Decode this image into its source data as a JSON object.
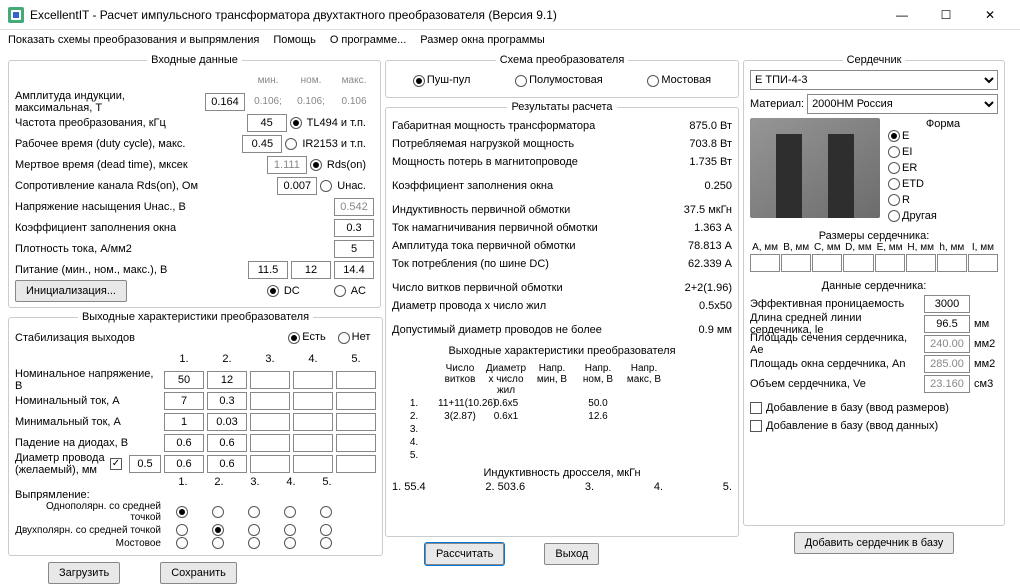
{
  "title": "ExcellentIT - Расчет импульсного трансформатора двухтактного преобразователя (Версия 9.1)",
  "menu": [
    "Показать схемы преобразования и выпрямления",
    "Помощь",
    "О программе...",
    "Размер окна программы"
  ],
  "input": {
    "legend": "Входные данные",
    "minmax": {
      "min": "мин.",
      "nom": "ном.",
      "max": "макс."
    },
    "rows": [
      {
        "label": "Амплитуда индукции, максимальная, Т",
        "val": "0.164",
        "min": "0.106;",
        "nom": "0.106;",
        "max": "0.106"
      },
      {
        "label": "Частота преобразования, кГц",
        "val": "45"
      },
      {
        "label": "Рабочее время (duty cycle), макс.",
        "val": "0.45"
      },
      {
        "label": "Мертвое время (dead time), мксек",
        "val": "1.111",
        "gray": true
      },
      {
        "label": "Сопротивление канала Rds(on), Ом",
        "val": "0.007"
      },
      {
        "label": "Напряжение насыщения Uнас., В",
        "val": "0.542",
        "gray": true
      },
      {
        "label": "Коэффициент заполнения окна",
        "val": "0.3"
      },
      {
        "label": "Плотность тока, А/мм2",
        "val": "5"
      }
    ],
    "driver": {
      "opts": [
        {
          "l": "TL494 и т.п.",
          "on": true
        },
        {
          "l": "IR2153 и т.п."
        },
        {
          "l": "Rds(on)",
          "on": true
        },
        {
          "l": "Uнас."
        }
      ]
    },
    "supply": {
      "label": "Питание (мин., ном., макс.), В",
      "v": [
        "11.5",
        "12",
        "14.4"
      ]
    },
    "init": "Инициализация...",
    "dca": {
      "dc": "DC",
      "ac": "AC",
      "sel": "DC"
    }
  },
  "out": {
    "legend": "Выходные характеристики преобразователя",
    "stab": {
      "label": "Стабилизация выходов",
      "yes": "Есть",
      "no": "Нет",
      "sel": "yes"
    },
    "cols": [
      "1.",
      "2.",
      "3.",
      "4.",
      "5."
    ],
    "rows": [
      {
        "l": "Номинальное напряжение, В",
        "v": [
          "50",
          "12",
          "",
          "",
          ""
        ]
      },
      {
        "l": "Номинальный ток, А",
        "v": [
          "7",
          "0.3",
          "",
          "",
          ""
        ]
      },
      {
        "l": "Минимальный ток, А",
        "v": [
          "1",
          "0.03",
          "",
          "",
          ""
        ]
      },
      {
        "l": "Падение на диодах, В",
        "v": [
          "0.6",
          "0.6",
          "",
          "",
          ""
        ]
      }
    ],
    "diam": {
      "l": "Диаметр провода (желаемый), мм",
      "chk": true,
      "v": [
        "0.5",
        "0.6",
        "0.6",
        "",
        "",
        ""
      ]
    },
    "rect": {
      "label": "Выпрямление:",
      "opts": [
        "Однополярн. со средней точкой",
        "Двухполярн. со средней точкой",
        "Мостовое"
      ],
      "sel": [
        0,
        1,
        null,
        null,
        null
      ]
    }
  },
  "btns": {
    "load": "Загрузить",
    "save": "Сохранить",
    "calc": "Рассчитать",
    "exit": "Выход",
    "addcore": "Добавить сердечник в базу"
  },
  "topology": {
    "legend": "Схема преобразователя",
    "opts": [
      {
        "l": "Пуш-пул",
        "on": true
      },
      {
        "l": "Полумостовая"
      },
      {
        "l": "Мостовая"
      }
    ]
  },
  "results": {
    "legend": "Результаты расчета",
    "rows": [
      {
        "l": "Габаритная мощность трансформатора",
        "v": "875.0 Вт"
      },
      {
        "l": "Потребляемая нагрузкой мощность",
        "v": "703.8 Вт"
      },
      {
        "l": "Мощность потерь в магнитопроводе",
        "v": "1.735 Вт"
      },
      {
        "l": "Коэффициент заполнения окна",
        "v": "0.250",
        "sp": true
      },
      {
        "l": "Индуктивность первичной обмотки",
        "v": "37.5 мкГн",
        "sp": true
      },
      {
        "l": "Ток намагничивания первичной обмотки",
        "v": "1.363 А"
      },
      {
        "l": "Амплитуда тока первичной обмотки",
        "v": "78.813 А"
      },
      {
        "l": "Ток потребления (по шине DC)",
        "v": "62.339 А"
      },
      {
        "l": "Число витков первичной обмотки",
        "v": "2+2(1.96)",
        "sp": true
      },
      {
        "l": "Диаметр провода х число жил",
        "v": "0.5x50"
      },
      {
        "l": "Допустимый диаметр проводов не более",
        "v": "0.9 мм",
        "sp": true
      }
    ],
    "outhdr": "Выходные характеристики преобразователя",
    "outcols": [
      "",
      "Число витков",
      "Диаметр х число жил",
      "Напр. мин, В",
      "Напр. ном, В",
      "Напр. макс, В"
    ],
    "outrows": [
      {
        "n": "1.",
        "v": [
          "11+11(10.26)",
          "0.6x5",
          "",
          "50.0",
          ""
        ]
      },
      {
        "n": "2.",
        "v": [
          "3(2.87)",
          "0.6x1",
          "",
          "12.6",
          ""
        ]
      },
      {
        "n": "3.",
        "v": [
          "",
          "",
          "",
          "",
          ""
        ]
      },
      {
        "n": "4.",
        "v": [
          "",
          "",
          "",
          "",
          ""
        ]
      },
      {
        "n": "5.",
        "v": [
          "",
          "",
          "",
          "",
          ""
        ]
      }
    ],
    "choke": {
      "l": "Индуктивность дросселя, мкГн",
      "v": [
        "1.   55.4",
        "2.   503.6",
        "3.",
        "4.",
        "5."
      ]
    }
  },
  "core": {
    "legend": "Сердечник",
    "sel": "E ТПИ-4-3",
    "mat_l": "Материал:",
    "mat": "2000НМ Россия",
    "shape_l": "Форма",
    "shapes": [
      {
        "l": "E",
        "on": true
      },
      {
        "l": "EI"
      },
      {
        "l": "ER"
      },
      {
        "l": "ETD"
      },
      {
        "l": "R"
      },
      {
        "l": "Другая"
      }
    ],
    "dims_l": "Размеры сердечника:",
    "dims": [
      "A, мм",
      "B, мм",
      "C, мм",
      "D, мм",
      "E, мм",
      "H, мм",
      "h, мм",
      "I, мм"
    ],
    "data_l": "Данные сердечника:",
    "data": [
      {
        "l": "Эффективная проницаемость",
        "v": "3000",
        "u": ""
      },
      {
        "l": "Длина средней линии сердечника, le",
        "v": "96.5",
        "u": "мм"
      },
      {
        "l": "Площадь сечения сердечника, Ae",
        "v": "240.00",
        "u": "мм2",
        "g": true
      },
      {
        "l": "Площадь окна сердечника, An",
        "v": "285.00",
        "u": "мм2",
        "g": true
      },
      {
        "l": "Объем сердечника, Ve",
        "v": "23.160",
        "u": "см3",
        "g": true
      }
    ],
    "cb1": "Добавление в базу (ввод размеров)",
    "cb2": "Добавление в базу (ввод данных)"
  }
}
